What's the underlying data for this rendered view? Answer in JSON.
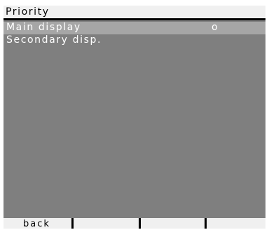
{
  "header": {
    "title": "Priority"
  },
  "menu": {
    "items": [
      {
        "label": "Main display",
        "mark": "o",
        "selected": true
      },
      {
        "label": "Secondary disp.",
        "mark": "",
        "selected": false
      }
    ]
  },
  "softkeys": {
    "k1": "back",
    "k2": "",
    "k3": "",
    "k4": ""
  },
  "colors": {
    "screen_bg": "#7f7f7f",
    "selection_bg": "#a6a6a6",
    "bar_bg": "#f0f0f0",
    "text_light": "#ffffff",
    "text_dark": "#000000"
  }
}
